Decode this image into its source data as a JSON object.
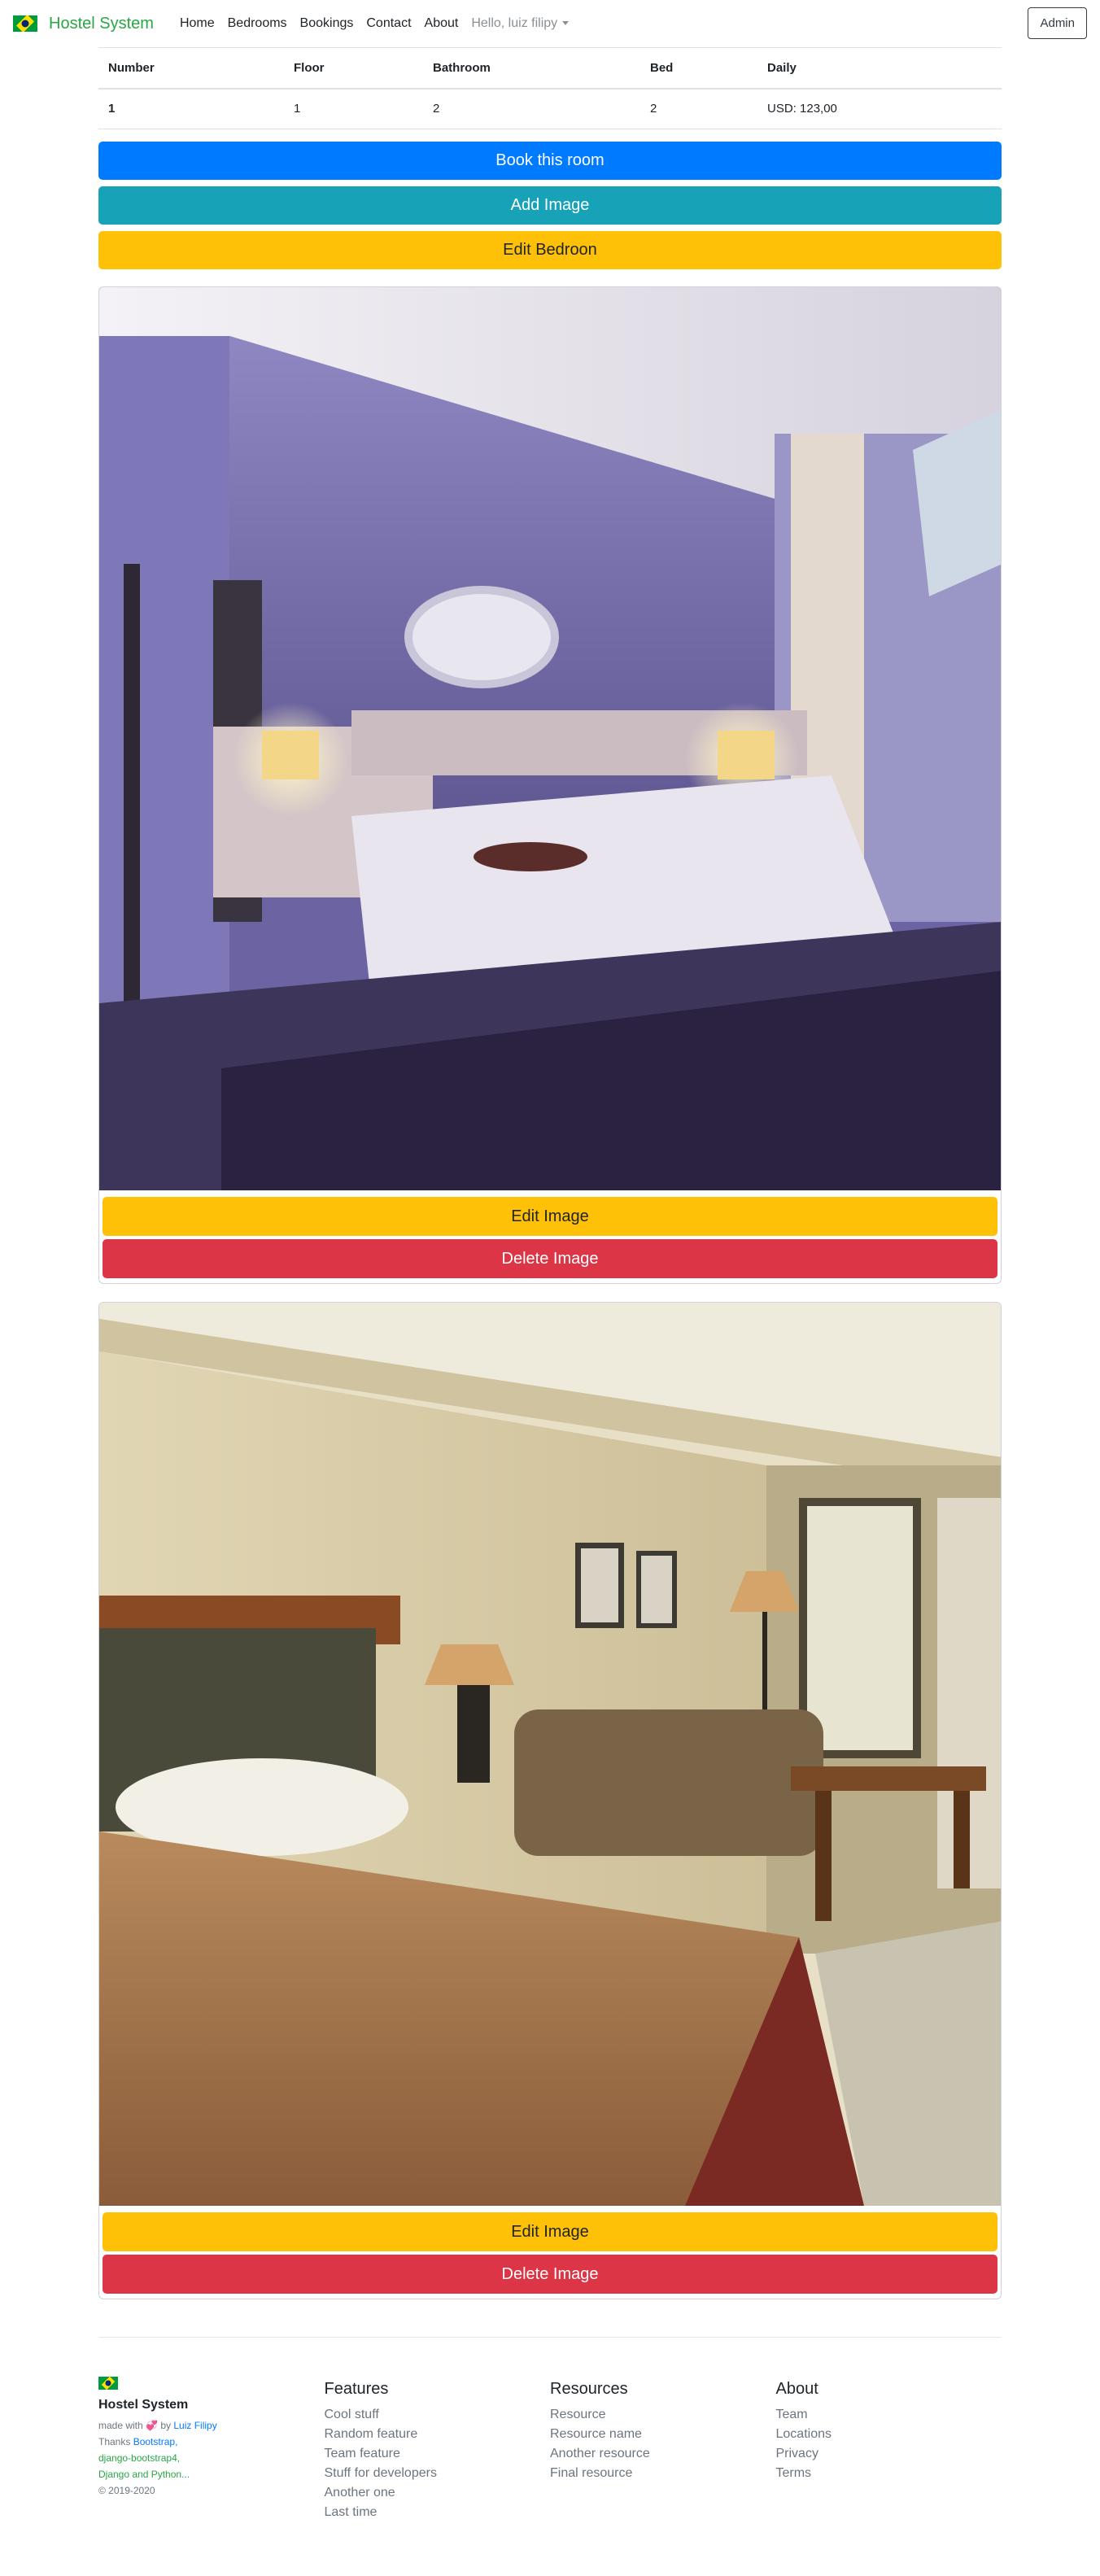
{
  "navbar": {
    "brand": "Hostel System",
    "links": [
      "Home",
      "Bedrooms",
      "Bookings",
      "Contact",
      "About"
    ],
    "user_menu": "Hello, luiz filipy",
    "admin_button": "Admin",
    "flag_icon": "brazil-flag-icon"
  },
  "room_table": {
    "headers": [
      "Number",
      "Floor",
      "Bathroom",
      "Bed",
      "Daily"
    ],
    "row": [
      "1",
      "1",
      "2",
      "2",
      "USD: 123,00"
    ]
  },
  "actions": {
    "book": "Book this room",
    "add_image": "Add Image",
    "edit_bedroom": "Edit Bedroon"
  },
  "images": [
    {
      "edit_label": "Edit Image",
      "delete_label": "Delete Image"
    },
    {
      "edit_label": "Edit Image",
      "delete_label": "Delete Image"
    }
  ],
  "footer": {
    "brand": "Hostel System",
    "made_with_prefix": "made with",
    "made_with_heart": "💞",
    "made_by_word": "by",
    "author": "Luiz Filipy",
    "thanks_prefix": "Thanks",
    "thanks_bootstrap": "Bootstrap,",
    "thanks_django_bootstrap": "django-bootstrap4,",
    "thanks_django_python": "Django and Python...",
    "copyright": "© 2019-2020",
    "columns": [
      {
        "title": "Features",
        "items": [
          "Cool stuff",
          "Random feature",
          "Team feature",
          "Stuff for developers",
          "Another one",
          "Last time"
        ]
      },
      {
        "title": "Resources",
        "items": [
          "Resource",
          "Resource name",
          "Another resource",
          "Final resource"
        ]
      },
      {
        "title": "About",
        "items": [
          "Team",
          "Locations",
          "Privacy",
          "Terms"
        ]
      }
    ]
  },
  "colors": {
    "primary": "#007bff",
    "info": "#17a2b8",
    "warning": "#ffc107",
    "danger": "#dc3545",
    "brand_green": "#28a745"
  }
}
